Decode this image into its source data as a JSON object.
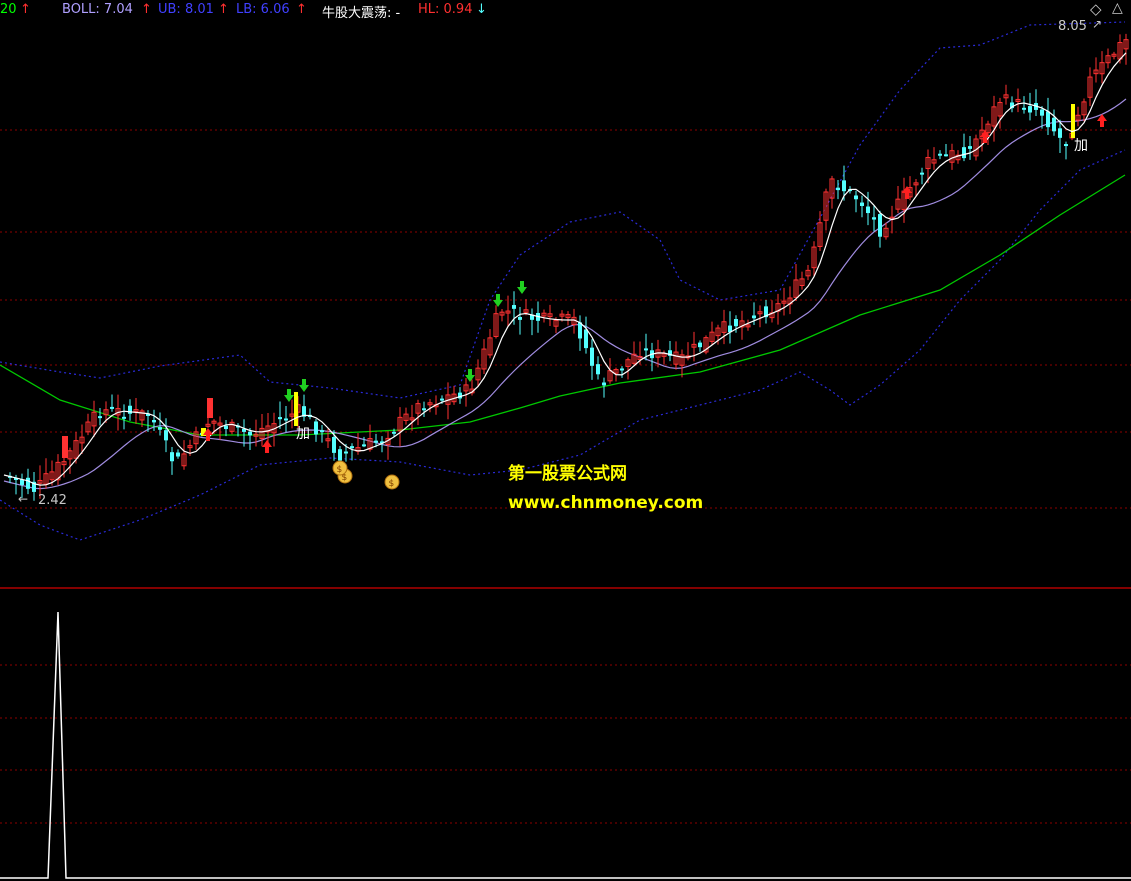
{
  "header": {
    "ma_period": "20",
    "boll": "BOLL: 7.04",
    "ub": "UB: 8.01",
    "lb": "LB: 6.06",
    "indicator_name": "牛股大震荡: -",
    "hl": "HL: 0.94",
    "up_arrow": "↑",
    "down_arrow": "↓",
    "diamond": "◇"
  },
  "colors": {
    "bg": "#000000",
    "up_candle": "#ff3232",
    "down_candle": "#54ffff",
    "ma_short": "#ffffff",
    "ma_mid": "#a08ce0",
    "ma_long": "#00c800",
    "band": "#2a2ad8",
    "grid": "#8b0000",
    "divider": "#b00000",
    "buy_arrow": "#ff2020",
    "sell_arrow": "#20d020",
    "highlight": "#ffff00",
    "watermark": "#ffff00"
  },
  "watermark": {
    "line1": "第一股票公式网",
    "line2": "www.chnmoney.com"
  },
  "chart_data": {
    "type": "candlestick",
    "annotations": {
      "low_label": "2.42",
      "high_label": "8.05",
      "add_label": "加",
      "money_icon": "money-bag-icon"
    },
    "ylim": [
      2.0,
      8.4
    ],
    "grid": true
  }
}
